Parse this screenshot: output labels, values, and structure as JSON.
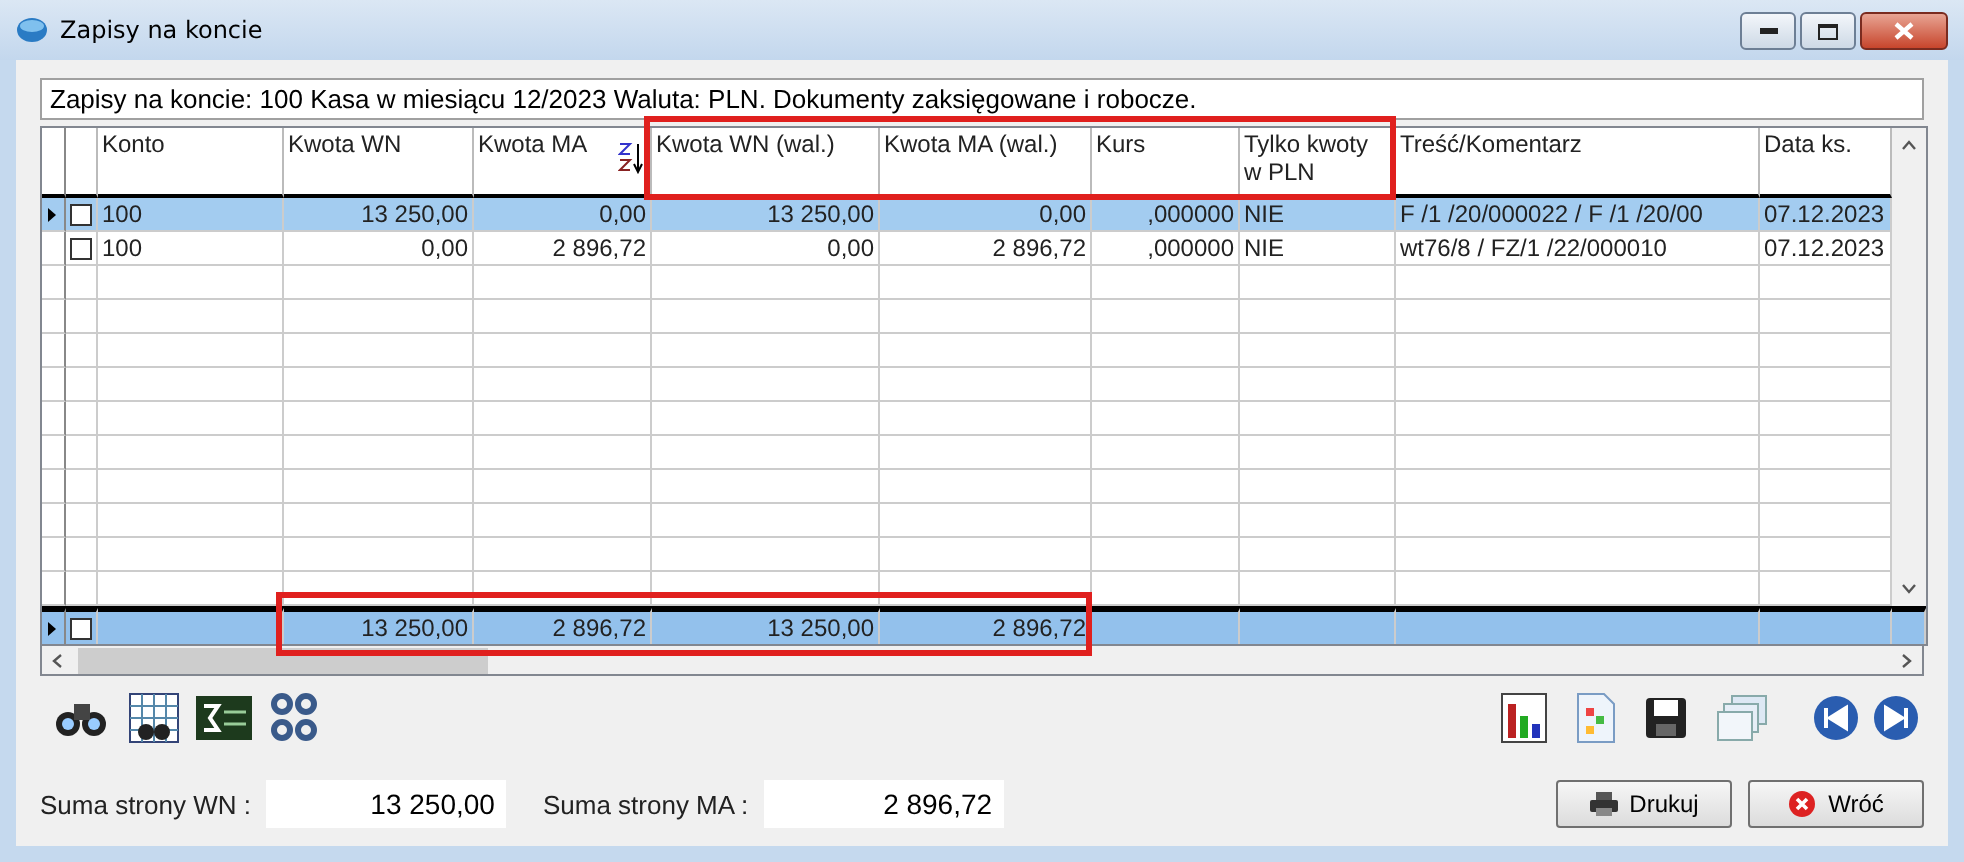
{
  "window": {
    "title": "Zapisy na koncie"
  },
  "info": "Zapisy na koncie: 100 Kasa w miesiącu 12/2023 Waluta: PLN. Dokumenty zaksięgowane i robocze.",
  "table": {
    "columns": [
      {
        "label": "Konto",
        "kind": "text",
        "sorted": false,
        "header_marked": false,
        "total_marked": false
      },
      {
        "label": "Kwota WN",
        "kind": "number",
        "sorted": false,
        "header_marked": false,
        "total_marked": true
      },
      {
        "label": "Kwota MA",
        "kind": "number",
        "sorted": true,
        "header_marked": false,
        "total_marked": true
      },
      {
        "label": "Kwota WN (wal.)",
        "kind": "number",
        "sorted": false,
        "header_marked": true,
        "total_marked": true
      },
      {
        "label": "Kwota MA (wal.)",
        "kind": "number",
        "sorted": false,
        "header_marked": true,
        "total_marked": true
      },
      {
        "label": "Kurs",
        "kind": "number",
        "sorted": false,
        "header_marked": true,
        "total_marked": false
      },
      {
        "label": "Tylko kwoty w PLN",
        "kind": "text",
        "sorted": false,
        "header_marked": true,
        "total_marked": false
      },
      {
        "label": "Treść/Komentarz",
        "kind": "text",
        "sorted": false,
        "header_marked": false,
        "total_marked": false
      },
      {
        "label": "Data ks.",
        "kind": "text",
        "sorted": false,
        "header_marked": false,
        "total_marked": false
      }
    ],
    "rows": [
      {
        "selected": true,
        "checked": false,
        "cells": [
          "100",
          "13 250,00",
          "0,00",
          "13 250,00",
          "0,00",
          ",000000",
          "NIE",
          "F /1  /20/000022 / F /1  /20/00",
          "07.12.2023"
        ]
      },
      {
        "selected": false,
        "checked": false,
        "cells": [
          "100",
          "0,00",
          "2 896,72",
          "0,00",
          "2 896,72",
          ",000000",
          "NIE",
          "wt76/8 / FZ/1  /22/000010",
          "07.12.2023"
        ]
      }
    ],
    "totals": {
      "checked": false,
      "cells": [
        "",
        "13 250,00",
        "2 896,72",
        "13 250,00",
        "2 896,72",
        "",
        "",
        "",
        ""
      ]
    }
  },
  "sums": [
    {
      "label": "Suma strony WN :",
      "value": "13 250,00"
    },
    {
      "label": "Suma strony MA :",
      "value": "2 896,72"
    }
  ],
  "buttons": [
    {
      "label": "Drukuj",
      "kind": "print"
    },
    {
      "label": "Wróć",
      "kind": "back"
    }
  ]
}
